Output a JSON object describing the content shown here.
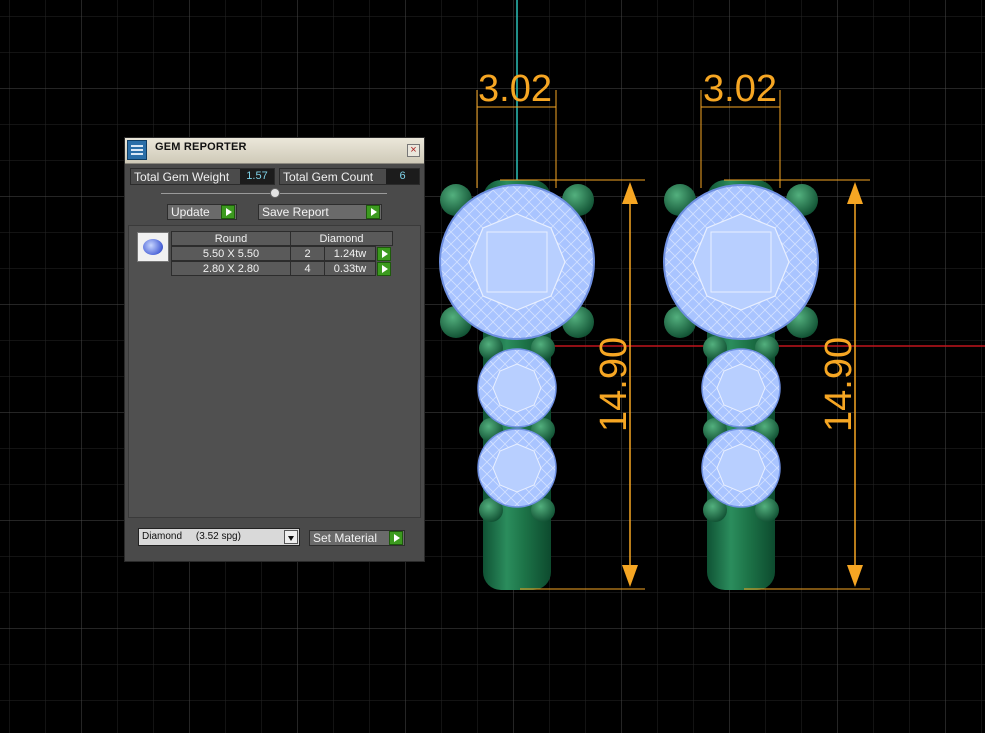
{
  "dimensions": {
    "width_label": "3.02",
    "height_label": "14.90"
  },
  "colors": {
    "dimension": "#f6a623",
    "gem": "#a9c4ff",
    "metal": "#1f7a4b",
    "grid": "#3c3c3c",
    "axis_x": "#c0141c",
    "axis_y": "#2bbfb8"
  },
  "panel": {
    "title": "GEM REPORTER",
    "close_icon": "close-icon",
    "total_weight_label": "Total Gem Weight",
    "total_weight_value": "1.57",
    "total_count_label": "Total Gem Count",
    "total_count_value": "6",
    "update_label": "Update",
    "save_report_label": "Save Report",
    "table": {
      "headers": [
        "Round",
        "Diamond"
      ],
      "rows": [
        {
          "size": "5.50 X 5.50",
          "count": "2",
          "weight": "1.24tw"
        },
        {
          "size": "2.80 X 2.80",
          "count": "4",
          "weight": "0.33tw"
        }
      ]
    },
    "material_value": "Diamond     (3.52 spg)",
    "set_material_label": "Set Material"
  }
}
